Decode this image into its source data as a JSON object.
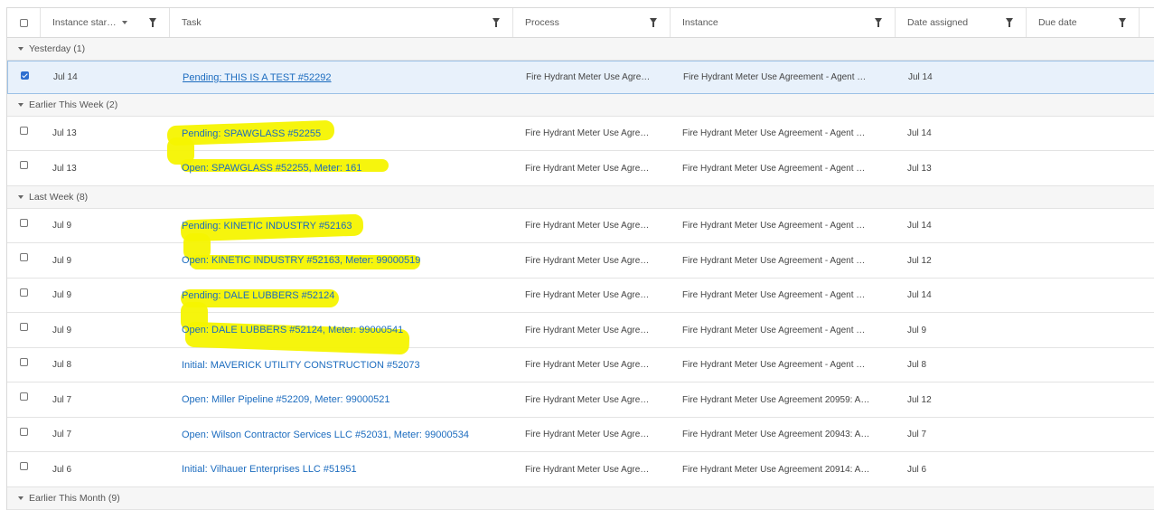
{
  "columns": {
    "instance_start": "Instance star…",
    "task": "Task",
    "process": "Process",
    "instance": "Instance",
    "date_assigned": "Date assigned",
    "due_date": "Due date"
  },
  "groups": [
    {
      "label": "Yesterday (1)"
    },
    {
      "label": "Earlier This Week (2)"
    },
    {
      "label": "Last Week (8)"
    },
    {
      "label": "Earlier This Month (9)"
    }
  ],
  "rows": [
    {
      "start": "Jul 14",
      "task": "Pending: THIS IS A TEST #52292",
      "process": "Fire Hydrant Meter Use Agre…",
      "instance": "Fire Hydrant Meter Use Agreement - Agent …",
      "assigned": "Jul 14",
      "due": ""
    },
    {
      "start": "Jul 13",
      "task": "Pending: SPAWGLASS #52255",
      "process": "Fire Hydrant Meter Use Agre…",
      "instance": "Fire Hydrant Meter Use Agreement - Agent …",
      "assigned": "Jul 14",
      "due": ""
    },
    {
      "start": "Jul 13",
      "task": "Open: SPAWGLASS #52255, Meter: 161",
      "process": "Fire Hydrant Meter Use Agre…",
      "instance": "Fire Hydrant Meter Use Agreement - Agent …",
      "assigned": "Jul 13",
      "due": ""
    },
    {
      "start": "Jul 9",
      "task": "Pending: KINETIC INDUSTRY #52163",
      "process": "Fire Hydrant Meter Use Agre…",
      "instance": "Fire Hydrant Meter Use Agreement - Agent …",
      "assigned": "Jul 14",
      "due": ""
    },
    {
      "start": "Jul 9",
      "task": "Open: KINETIC INDUSTRY #52163, Meter: 99000519",
      "process": "Fire Hydrant Meter Use Agre…",
      "instance": "Fire Hydrant Meter Use Agreement - Agent …",
      "assigned": "Jul 12",
      "due": ""
    },
    {
      "start": "Jul 9",
      "task": "Pending: DALE LUBBERS #52124",
      "process": "Fire Hydrant Meter Use Agre…",
      "instance": "Fire Hydrant Meter Use Agreement - Agent …",
      "assigned": "Jul 14",
      "due": ""
    },
    {
      "start": "Jul 9",
      "task": "Open: DALE LUBBERS #52124, Meter: 99000541",
      "process": "Fire Hydrant Meter Use Agre…",
      "instance": "Fire Hydrant Meter Use Agreement - Agent …",
      "assigned": "Jul 9",
      "due": ""
    },
    {
      "start": "Jul 8",
      "task": "Initial: MAVERICK UTILITY CONSTRUCTION #52073",
      "process": "Fire Hydrant Meter Use Agre…",
      "instance": "Fire Hydrant Meter Use Agreement - Agent …",
      "assigned": "Jul 8",
      "due": ""
    },
    {
      "start": "Jul 7",
      "task": "Open: Miller Pipeline #52209, Meter: 99000521",
      "process": "Fire Hydrant Meter Use Agre…",
      "instance": "Fire Hydrant Meter Use Agreement 20959: A…",
      "assigned": "Jul 12",
      "due": ""
    },
    {
      "start": "Jul 7",
      "task": "Open: Wilson Contractor Services LLC #52031, Meter: 99000534",
      "process": "Fire Hydrant Meter Use Agre…",
      "instance": "Fire Hydrant Meter Use Agreement 20943: A…",
      "assigned": "Jul 7",
      "due": ""
    },
    {
      "start": "Jul 6",
      "task": "Initial: Vilhauer Enterprises LLC #51951",
      "process": "Fire Hydrant Meter Use Agre…",
      "instance": "Fire Hydrant Meter Use Agreement 20914: A…",
      "assigned": "Jul 6",
      "due": ""
    }
  ],
  "selected_row": 0,
  "colors": {
    "link": "#1c6cbf",
    "highlight": "#f6f400",
    "selected_bg": "#e8f1fb"
  }
}
